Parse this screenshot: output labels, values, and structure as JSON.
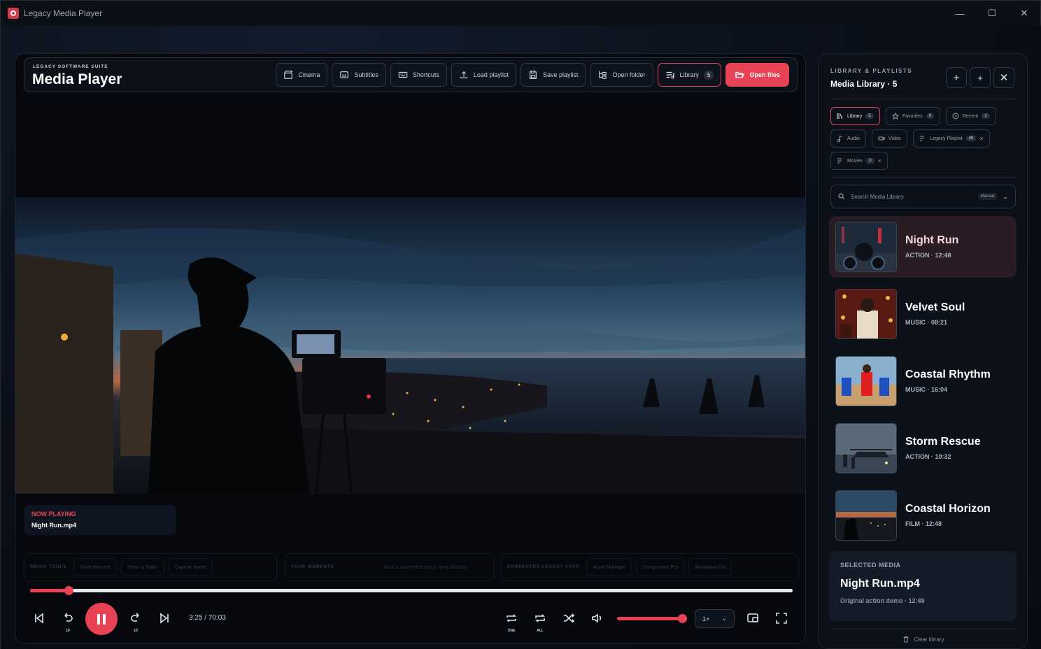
{
  "window": {
    "title": "Legacy Media Player"
  },
  "header": {
    "suite": "LEGACY SOFTWARE SUITE",
    "title": "Media Player",
    "buttons": {
      "cinema": "Cinema",
      "subtitles": "Subtitles",
      "shortcuts": "Shortcuts",
      "load_playlist": "Load playlist",
      "save_playlist": "Save playlist",
      "open_folder": "Open folder",
      "library": "Library",
      "library_count": "5",
      "open_files": "Open files"
    }
  },
  "now_playing": {
    "label": "NOW PLAYING",
    "title": "Night Run.mp4"
  },
  "tools": {
    "media_tools_label": "MEDIA TOOLS",
    "save_moment": "Save Moment",
    "show_in_folder": "Show in folder",
    "capture_frame": "Capture frame",
    "moments_label": "YOUR MOMENTS",
    "moments_hint": "Save a moment to return here instantly",
    "apps_label": "CONNECTED LEGACY APPS",
    "asset_manager": "Asset Manager",
    "compressor_pro": "Compressor Pro",
    "broadcast_os": "Broadcast OS"
  },
  "playback": {
    "progress": 0.05,
    "time": "3:25 / 70:03",
    "rewind_sub": "10",
    "forward_sub": "10",
    "repeat_one_sub": "ONE",
    "repeat_all_sub": "ALL",
    "volume": 1.0,
    "speed": "1×"
  },
  "library": {
    "section_label": "LIBRARY & PLAYLISTS",
    "title": "Media Library · 5",
    "chips": {
      "library": "Library",
      "library_count": "5",
      "favorites": "Favorites",
      "favorites_count": "0",
      "recent": "Recent",
      "recent_count": "1",
      "audio": "Audio",
      "video": "Video",
      "legacy_playlist": "Legacy Playlist",
      "legacy_playlist_count": "48",
      "movies": "Movies",
      "movies_count": "0"
    },
    "search_placeholder": "Search Media Library",
    "sort": "Manual",
    "items": [
      {
        "title": "Night Run",
        "meta": "ACTION · 12:48"
      },
      {
        "title": "Velvet Soul",
        "meta": "MUSIC · 08:21"
      },
      {
        "title": "Coastal Rhythm",
        "meta": "MUSIC · 16:04"
      },
      {
        "title": "Storm Rescue",
        "meta": "ACTION · 10:32"
      },
      {
        "title": "Coastal Horizon",
        "meta": "FILM · 12:48"
      }
    ],
    "selected": {
      "label": "SELECTED MEDIA",
      "title": "Night Run.mp4",
      "meta": "Original action demo · 12:48"
    },
    "clear": "Clear library"
  },
  "colors": {
    "accent": "#e84354",
    "background": "#070b12",
    "panel": "#0b1019"
  }
}
